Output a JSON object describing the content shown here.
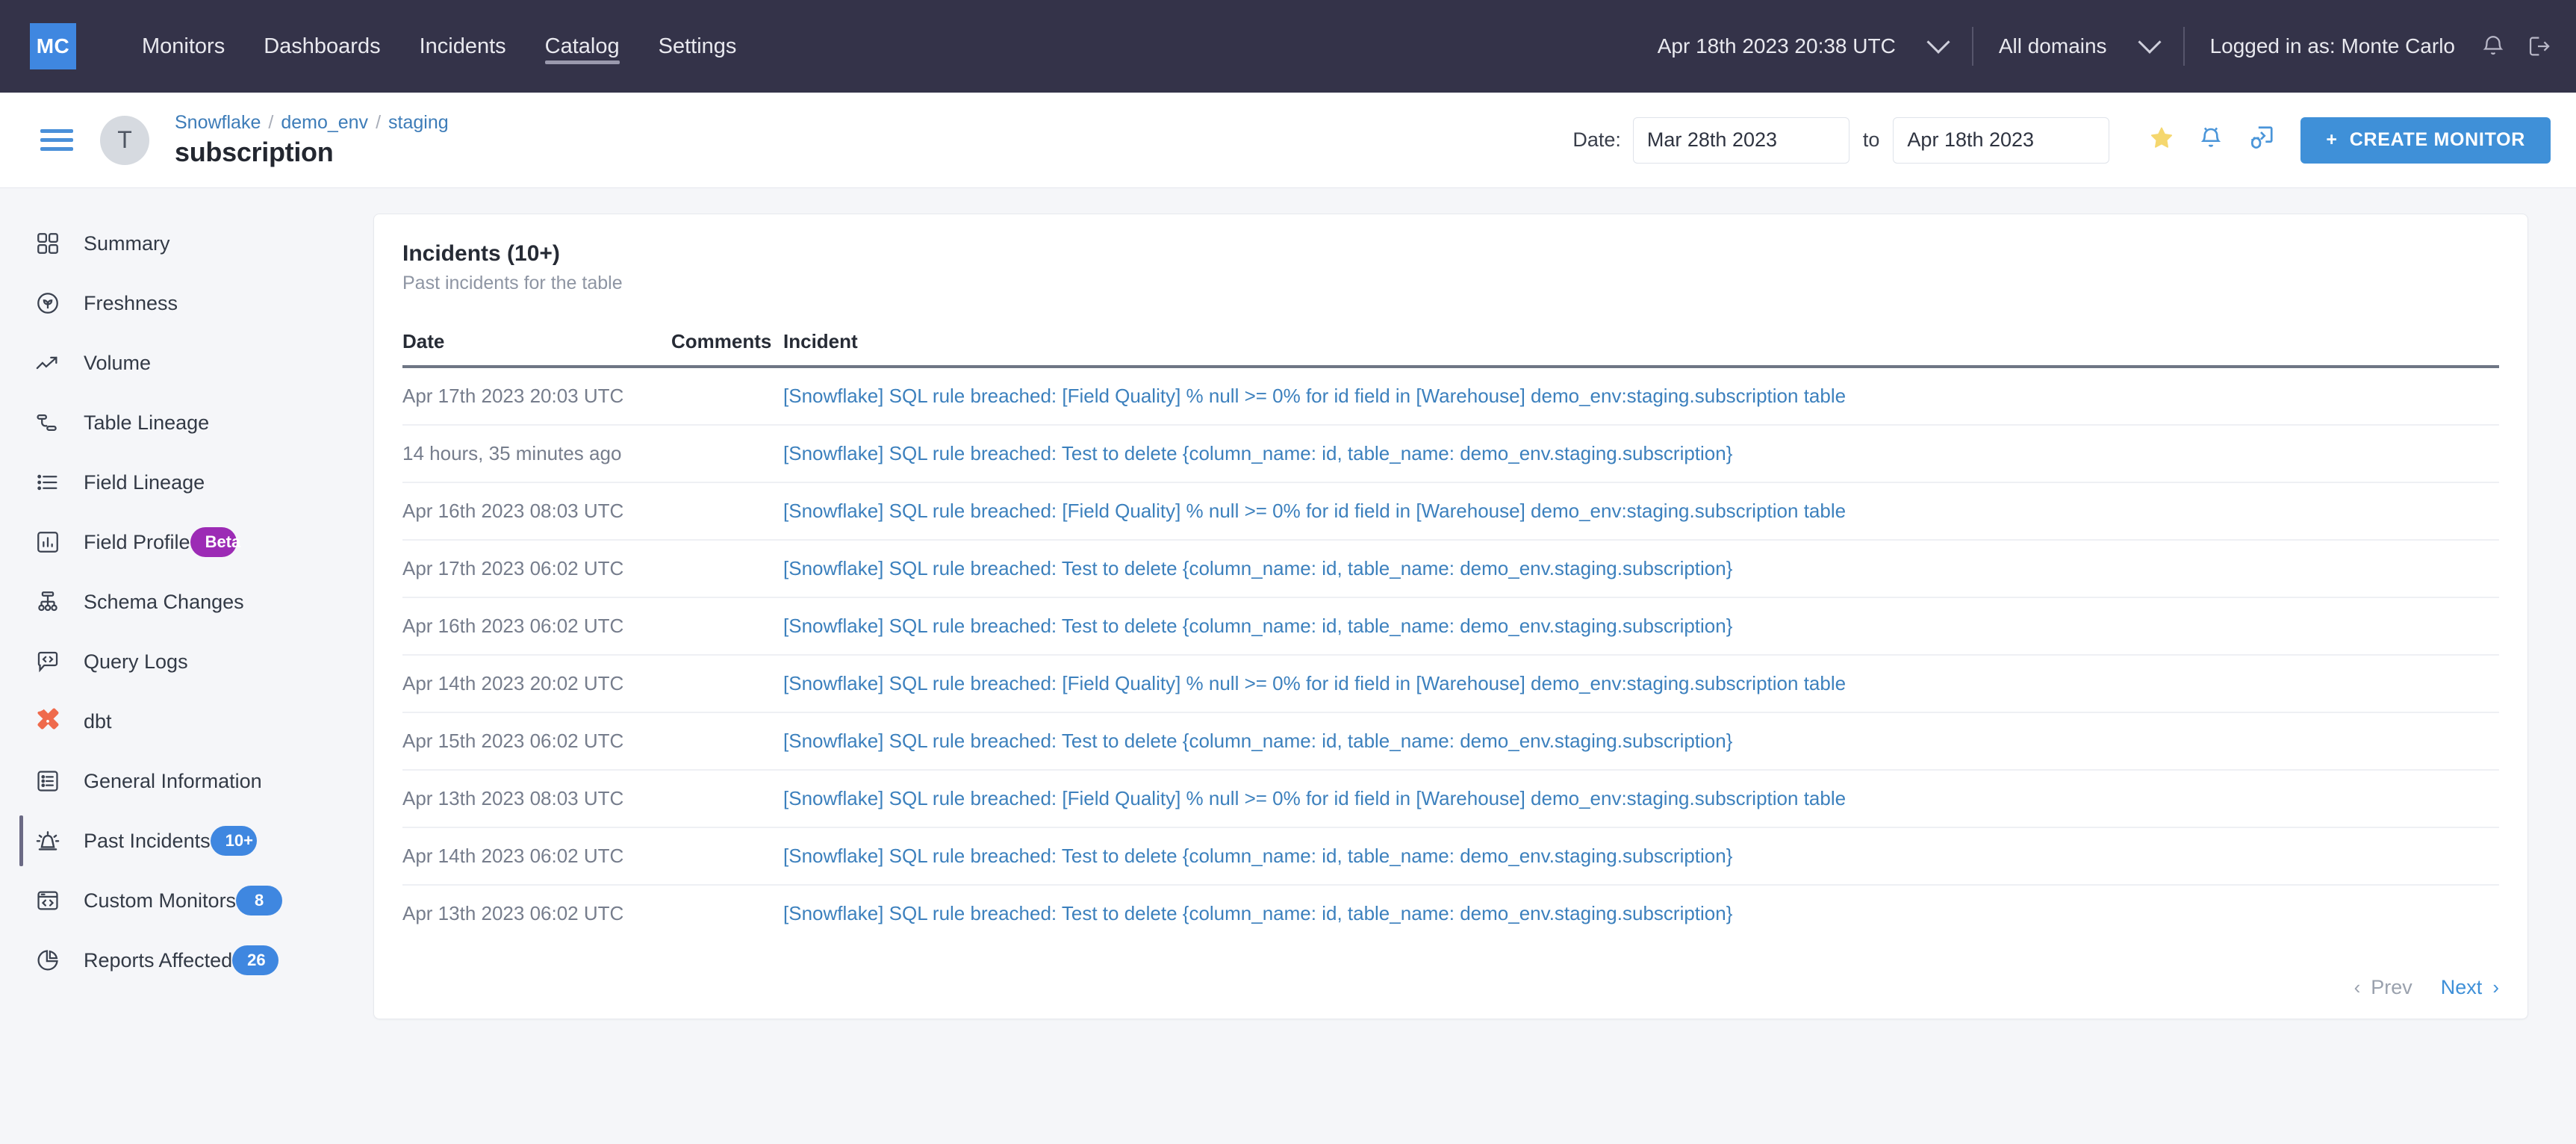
{
  "topnav": {
    "logo": "MC",
    "links": [
      {
        "label": "Monitors",
        "active": false
      },
      {
        "label": "Dashboards",
        "active": false
      },
      {
        "label": "Incidents",
        "active": false
      },
      {
        "label": "Catalog",
        "active": true
      },
      {
        "label": "Settings",
        "active": false
      }
    ],
    "timestamp": "Apr 18th 2023 20:38 UTC",
    "domain": "All domains",
    "user": "Logged in as: Monte Carlo",
    "icons": [
      "bell-icon",
      "logout-icon"
    ]
  },
  "subheader": {
    "avatar_initial": "T",
    "breadcrumb": [
      "Snowflake",
      "demo_env",
      "staging"
    ],
    "breadcrumb_sep": "/",
    "title": "subscription",
    "date_label": "Date:",
    "date_from": "Mar 28th 2023",
    "date_to_label": "to",
    "date_to": "Apr 18th 2023",
    "icons": [
      "star-icon",
      "bell-icon",
      "bug-export-icon"
    ],
    "create_button": "CREATE MONITOR",
    "create_button_plus": "+"
  },
  "sidebar": {
    "items": [
      {
        "label": "Summary",
        "icon": "grid-icon",
        "badge": null,
        "badge_type": null,
        "active": false
      },
      {
        "label": "Freshness",
        "icon": "sprout-icon",
        "badge": null,
        "badge_type": null,
        "active": false
      },
      {
        "label": "Volume",
        "icon": "trend-up-icon",
        "badge": null,
        "badge_type": null,
        "active": false
      },
      {
        "label": "Table Lineage",
        "icon": "table-lineage-icon",
        "badge": null,
        "badge_type": null,
        "active": false
      },
      {
        "label": "Field Lineage",
        "icon": "list-icon",
        "badge": null,
        "badge_type": null,
        "active": false
      },
      {
        "label": "Field Profile",
        "icon": "bar-chart-icon",
        "badge": "Beta",
        "badge_type": "beta",
        "active": false
      },
      {
        "label": "Schema Changes",
        "icon": "hierarchy-icon",
        "badge": null,
        "badge_type": null,
        "active": false
      },
      {
        "label": "Query Logs",
        "icon": "code-bubble-icon",
        "badge": null,
        "badge_type": null,
        "active": false
      },
      {
        "label": "dbt",
        "icon": "dbt-icon",
        "badge": null,
        "badge_type": null,
        "active": false
      },
      {
        "label": "General Information",
        "icon": "info-list-icon",
        "badge": null,
        "badge_type": null,
        "active": false
      },
      {
        "label": "Past Incidents",
        "icon": "siren-icon",
        "badge": "10+",
        "badge_type": "count",
        "active": true
      },
      {
        "label": "Custom Monitors",
        "icon": "code-window-icon",
        "badge": "8",
        "badge_type": "count",
        "active": false
      },
      {
        "label": "Reports Affected",
        "icon": "pie-chart-icon",
        "badge": "26",
        "badge_type": "count",
        "active": false
      }
    ]
  },
  "card": {
    "title": "Incidents (10+)",
    "subtitle": "Past incidents for the table",
    "columns": [
      "Date",
      "Comments",
      "Incident"
    ],
    "rows": [
      {
        "date": "Apr 17th 2023 20:03 UTC",
        "comments": "",
        "incident": "[Snowflake] SQL rule breached: [Field Quality] % null >= 0% for id field in [Warehouse] demo_env:staging.subscription table"
      },
      {
        "date": "14 hours, 35 minutes ago",
        "comments": "",
        "incident": "[Snowflake] SQL rule breached: Test to delete {column_name: id, table_name: demo_env.staging.subscription}"
      },
      {
        "date": "Apr 16th 2023 08:03 UTC",
        "comments": "",
        "incident": "[Snowflake] SQL rule breached: [Field Quality] % null >= 0% for id field in [Warehouse] demo_env:staging.subscription table"
      },
      {
        "date": "Apr 17th 2023 06:02 UTC",
        "comments": "",
        "incident": "[Snowflake] SQL rule breached: Test to delete {column_name: id, table_name: demo_env.staging.subscription}"
      },
      {
        "date": "Apr 16th 2023 06:02 UTC",
        "comments": "",
        "incident": "[Snowflake] SQL rule breached: Test to delete {column_name: id, table_name: demo_env.staging.subscription}"
      },
      {
        "date": "Apr 14th 2023 20:02 UTC",
        "comments": "",
        "incident": "[Snowflake] SQL rule breached: [Field Quality] % null >= 0% for id field in [Warehouse] demo_env:staging.subscription table"
      },
      {
        "date": "Apr 15th 2023 06:02 UTC",
        "comments": "",
        "incident": "[Snowflake] SQL rule breached: Test to delete {column_name: id, table_name: demo_env.staging.subscription}"
      },
      {
        "date": "Apr 13th 2023 08:03 UTC",
        "comments": "",
        "incident": "[Snowflake] SQL rule breached: [Field Quality] % null >= 0% for id field in [Warehouse] demo_env:staging.subscription table"
      },
      {
        "date": "Apr 14th 2023 06:02 UTC",
        "comments": "",
        "incident": "[Snowflake] SQL rule breached: Test to delete {column_name: id, table_name: demo_env.staging.subscription}"
      },
      {
        "date": "Apr 13th 2023 06:02 UTC",
        "comments": "",
        "incident": "[Snowflake] SQL rule breached: Test to delete {column_name: id, table_name: demo_env.staging.subscription}"
      }
    ],
    "pagination": {
      "prev": "Prev",
      "next": "Next",
      "prev_chevron": "‹",
      "next_chevron": "›"
    }
  },
  "colors": {
    "brand_blue": "#3f87e0",
    "nav_dark": "#343349",
    "link_blue": "#3c80bd",
    "beta_purple": "#9c2bb5",
    "star_yellow": "#f5d76e",
    "dbt_orange": "#ef6a4c"
  }
}
